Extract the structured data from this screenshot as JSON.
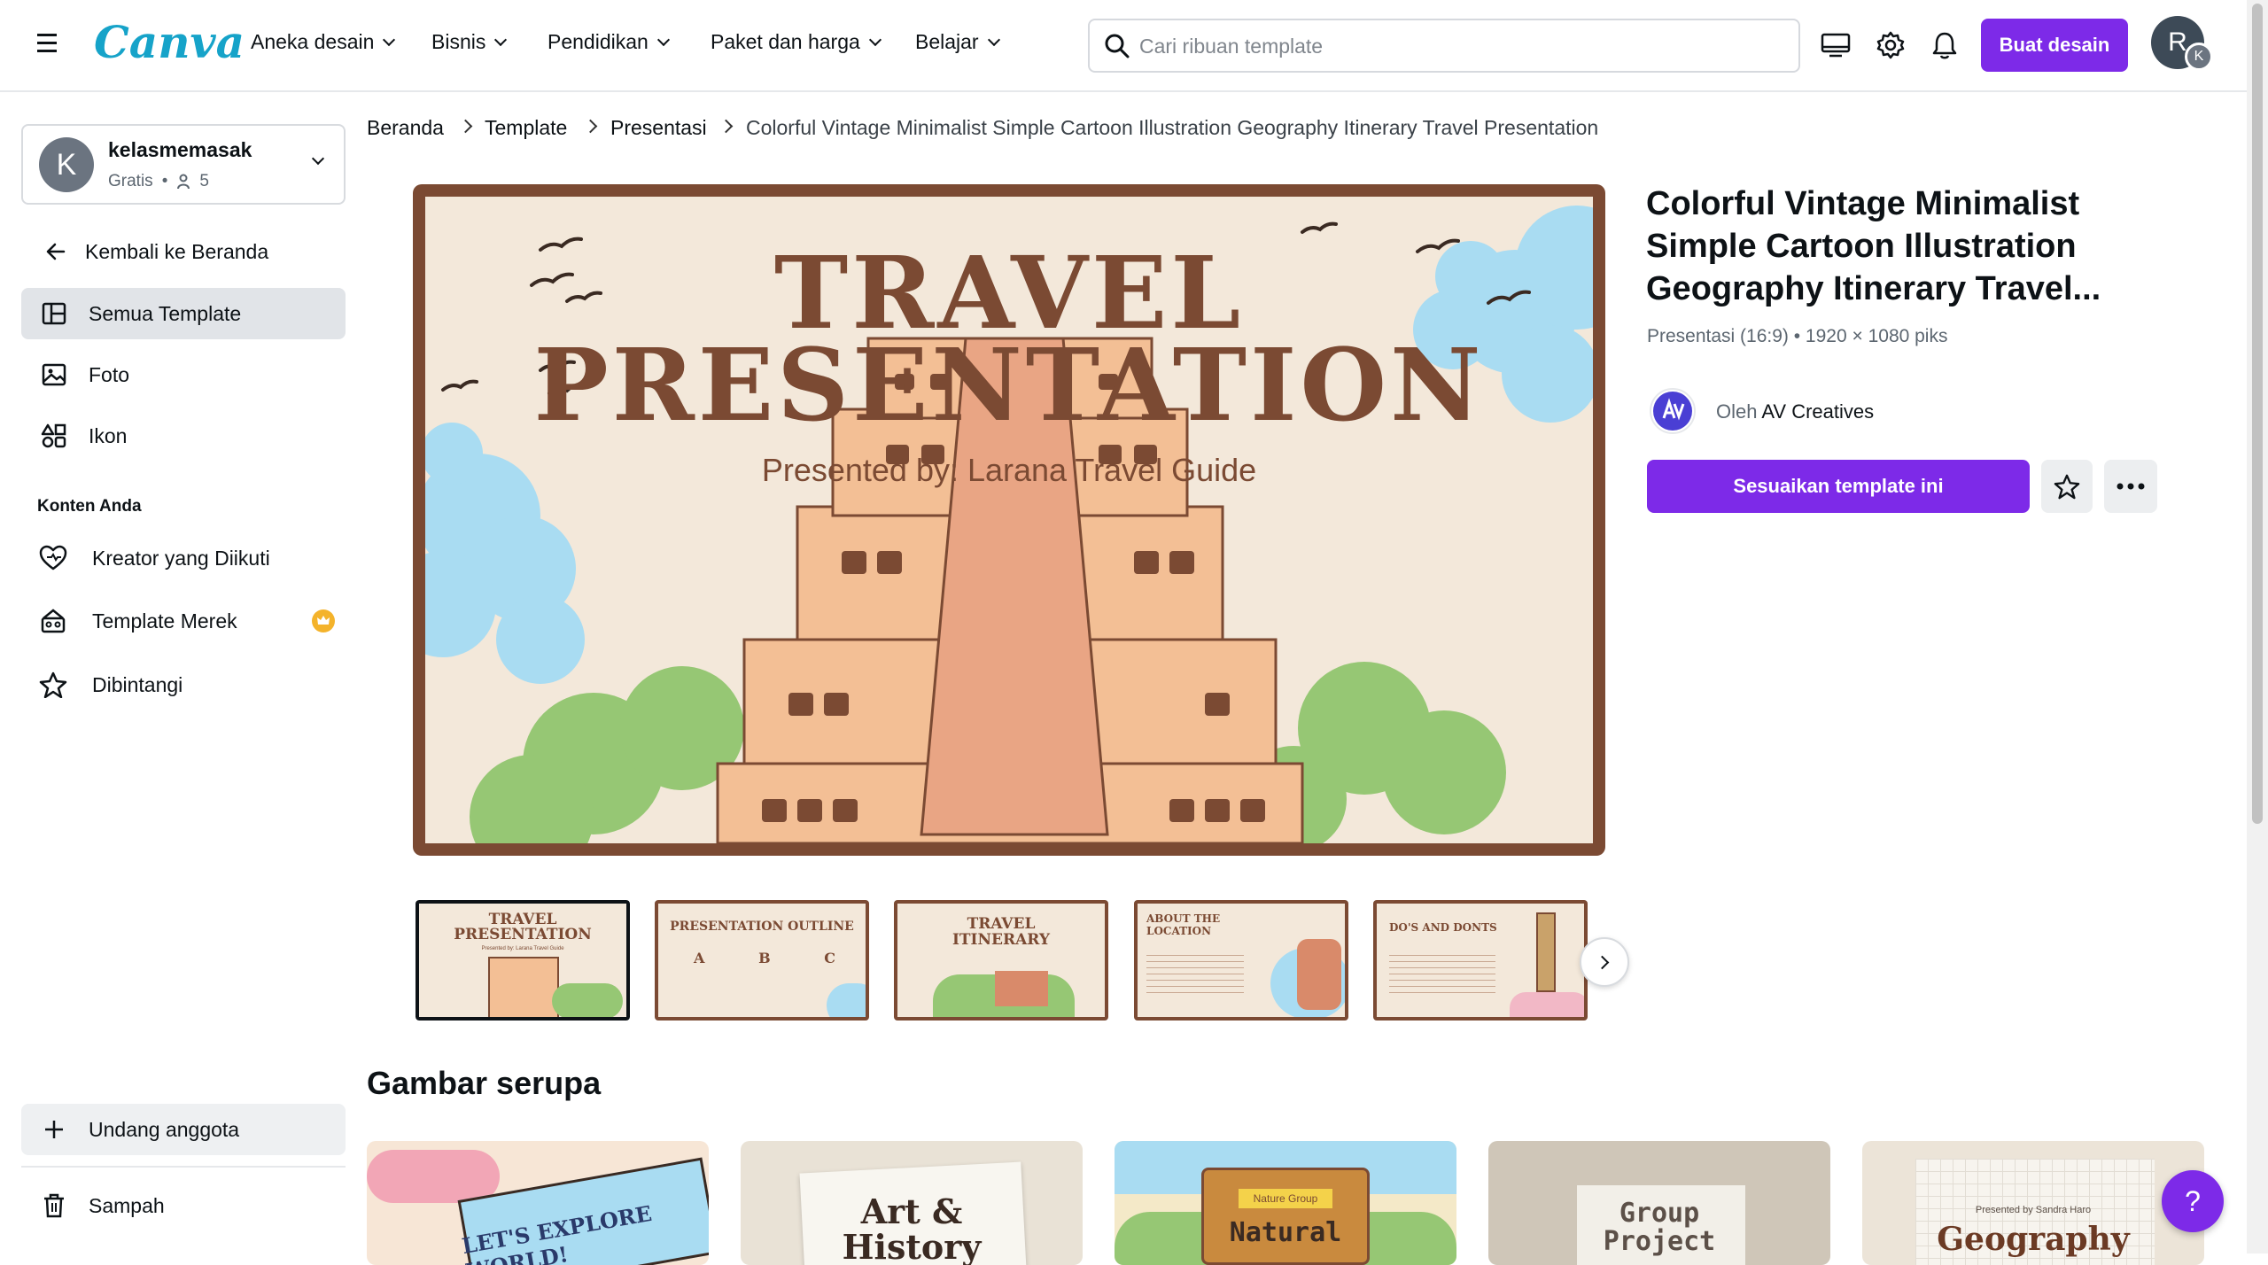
{
  "header": {
    "logo": "Canva",
    "nav": [
      "Aneka desain",
      "Bisnis",
      "Pendidikan",
      "Paket dan harga",
      "Belajar"
    ],
    "search_placeholder": "Cari ribuan template",
    "create_button": "Buat desain",
    "avatar_initial": "R",
    "avatar_badge": "K"
  },
  "sidebar": {
    "workspace": {
      "initial": "K",
      "name": "kelasmemasak",
      "plan": "Gratis",
      "members": "5"
    },
    "back": "Kembali ke Beranda",
    "items": [
      "Semua Template",
      "Foto",
      "Ikon"
    ],
    "section_label": "Konten Anda",
    "content_items": [
      "Kreator yang Diikuti",
      "Template Merek",
      "Dibintangi"
    ],
    "invite": "Undang anggota",
    "trash": "Sampah"
  },
  "breadcrumb": [
    "Beranda",
    "Template",
    "Presentasi",
    "Colorful Vintage Minimalist Simple Cartoon Illustration Geography Itinerary Travel Presentation"
  ],
  "slide": {
    "title_line1": "TRAVEL",
    "title_line2": "PRESENTATION",
    "subtitle": "Presented by: Larana Travel Guide"
  },
  "thumbnails": [
    {
      "title": "TRAVEL PRESENTATION",
      "sub": "Presented by: Larana Travel Guide"
    },
    {
      "title": "PRESENTATION OUTLINE",
      "cols": [
        "A",
        "B",
        "C"
      ]
    },
    {
      "title": "TRAVEL ITINERARY"
    },
    {
      "title": "ABOUT THE LOCATION"
    },
    {
      "title": "DO'S AND DONTS"
    }
  ],
  "details": {
    "title": "Colorful Vintage Minimalist Simple Cartoon Illustration Geography Itinerary Travel...",
    "meta": "Presentasi (16:9) • 1920 × 1080 piks",
    "by_prefix": "Oleh",
    "creator": "AV Creatives",
    "customize_button": "Sesuaikan template ini"
  },
  "similar": {
    "heading": "Gambar serupa",
    "cards": [
      {
        "text": "LET'S EXPLORE WORLD!",
        "bg": "#f7e6d6"
      },
      {
        "text": "Art & History",
        "bg": "#e9e2d6"
      },
      {
        "text": "Natural",
        "sub": "Nature Group",
        "bg": "#f4e9c8"
      },
      {
        "text": "Group Project",
        "bg": "#cfc6b8"
      },
      {
        "text": "Geography",
        "sub": "Presented by Sandra Haro",
        "bg": "#ece4d8"
      }
    ]
  },
  "help_button": "?",
  "colors": {
    "accent": "#7d2ae8",
    "slide_border": "#7b4a33",
    "slide_bg": "#f3e8da",
    "logo": "#16a3c9"
  }
}
